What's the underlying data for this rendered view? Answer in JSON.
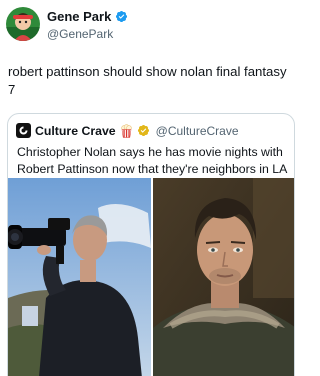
{
  "author": {
    "display_name": "Gene Park",
    "handle": "@GenePark",
    "verified_icon": "blue-check-icon"
  },
  "tweet": {
    "text": "robert pattinson should show nolan final fantasy 7"
  },
  "quote": {
    "display_name": "Culture Crave",
    "emoji": "popcorn-icon",
    "badge": "gold-check-icon",
    "handle": "@CultureCrave",
    "text": "Christopher Nolan says he has movie nights with Robert Pattinson now that they're neighbors in LA"
  },
  "colors": {
    "verified_blue": "#1d9bf0",
    "gold_badge": "#e2b719",
    "secondary_text": "#536471",
    "border": "#cfd9de"
  }
}
